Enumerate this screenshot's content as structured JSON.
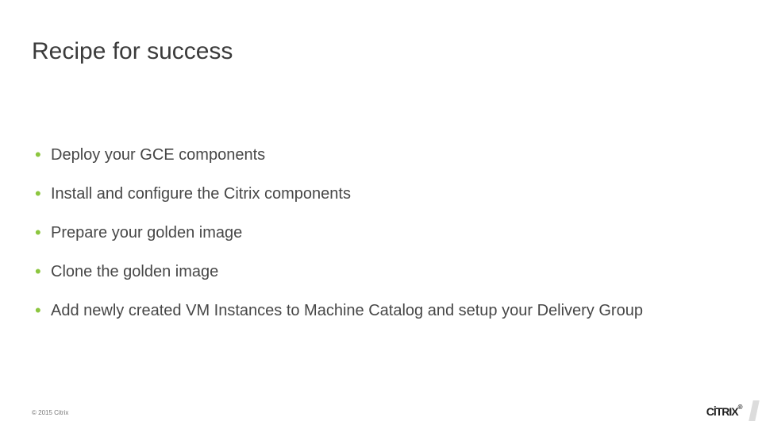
{
  "title": "Recipe for success",
  "bullets": [
    "Deploy your GCE components",
    "Install and configure the Citrix components",
    "Prepare your golden image",
    "Clone the golden image",
    "Add newly created VM Instances to Machine Catalog and setup your Delivery Group"
  ],
  "footer": "© 2015 Citrix",
  "logo": "CİTRIX",
  "logo_mark": "®"
}
